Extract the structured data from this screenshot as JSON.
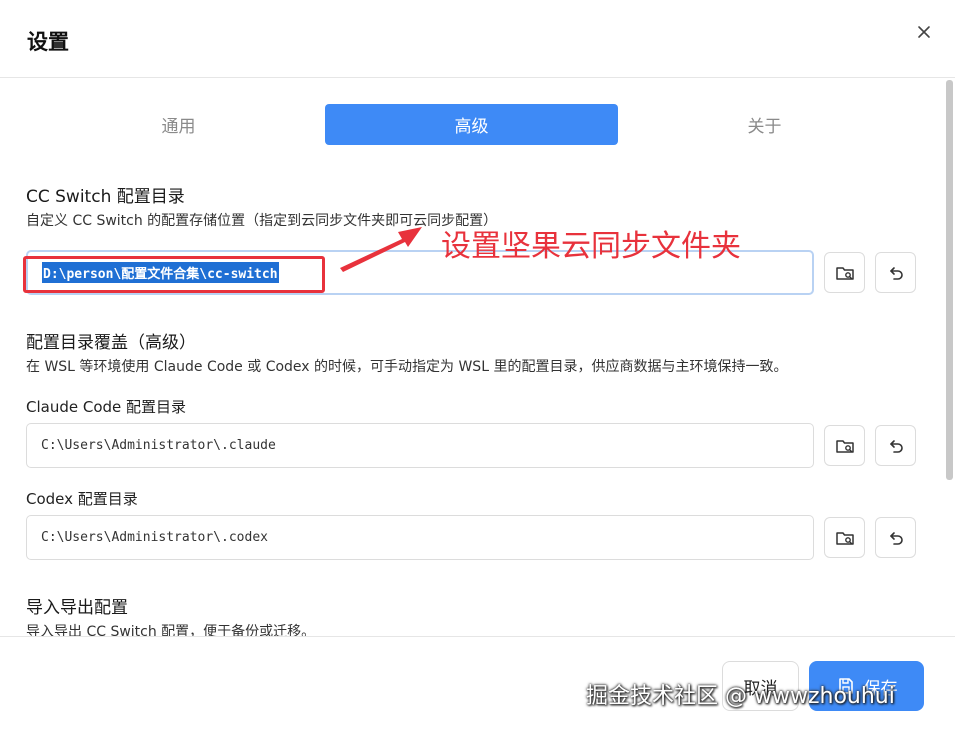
{
  "dialog": {
    "title": "设置"
  },
  "tabs": [
    {
      "label": "通用",
      "active": false
    },
    {
      "label": "高级",
      "active": true
    },
    {
      "label": "关于",
      "active": false
    }
  ],
  "config_dir": {
    "title": "CC Switch 配置目录",
    "description": "自定义 CC Switch 的配置存储位置（指定到云同步文件夹即可云同步配置）",
    "value": "D:\\person\\配置文件合集\\cc-switch"
  },
  "override": {
    "title": "配置目录覆盖（高级）",
    "description": "在 WSL 等环境使用 Claude Code 或 Codex 的时候，可手动指定为 WSL 里的配置目录，供应商数据与主环境保持一致。",
    "claude_label": "Claude Code 配置目录",
    "claude_value": "C:\\Users\\Administrator\\.claude",
    "codex_label": "Codex 配置目录",
    "codex_value": "C:\\Users\\Administrator\\.codex"
  },
  "import_export": {
    "title": "导入导出配置",
    "description": "导入导出 CC Switch 配置，便于备份或迁移。"
  },
  "annotation": {
    "text": "设置坚果云同步文件夹",
    "color": "#e8323c"
  },
  "footer": {
    "cancel_label": "取消",
    "save_label": "保存"
  },
  "watermark": "掘金技术社区 @ wwwzhouhui",
  "colors": {
    "accent": "#3e8af6",
    "annotation": "#e8323c"
  },
  "icons": [
    "close-icon",
    "folder-search-icon",
    "undo-icon",
    "save-icon"
  ]
}
